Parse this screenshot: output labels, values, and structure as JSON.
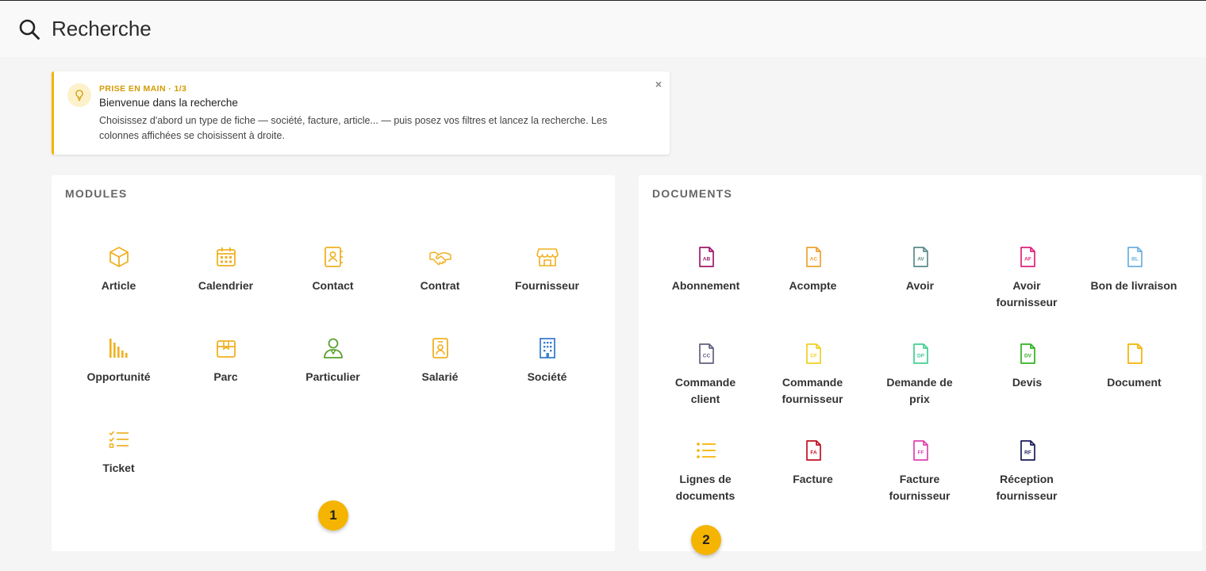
{
  "header": {
    "title": "Recherche"
  },
  "tip": {
    "kicker": "PRISE EN MAIN · 1/3",
    "heading": "Bienvenue dans la recherche",
    "body": "Choisissez d'abord un type de fiche — société, facture, article... — puis posez vos filtres et lancez la recherche. Les colonnes affichées se choisissent à droite.",
    "close": "×"
  },
  "modules": {
    "title": "MODULES",
    "items": [
      {
        "label": "Article",
        "icon": "box-icon"
      },
      {
        "label": "Calendrier",
        "icon": "calendar-icon"
      },
      {
        "label": "Contact",
        "icon": "contact-book-icon"
      },
      {
        "label": "Contrat",
        "icon": "handshake-icon"
      },
      {
        "label": "Fournisseur",
        "icon": "store-icon"
      },
      {
        "label": "Opportunité",
        "icon": "bar-chart-icon"
      },
      {
        "label": "Parc",
        "icon": "package-icon"
      },
      {
        "label": "Particulier",
        "icon": "person-icon"
      },
      {
        "label": "Salarié",
        "icon": "badge-icon"
      },
      {
        "label": "Société",
        "icon": "building-icon"
      },
      {
        "label": "Ticket",
        "icon": "checklist-icon"
      }
    ]
  },
  "documents": {
    "title": "DOCUMENTS",
    "items": [
      {
        "label": "Abonnement",
        "code": "AB",
        "color": "#a0186a"
      },
      {
        "label": "Acompte",
        "code": "AC",
        "color": "#f0a030"
      },
      {
        "label": "Avoir",
        "code": "AV",
        "color": "#5a8a8a"
      },
      {
        "label": "Avoir fournisseur",
        "code": "AF",
        "color": "#e0207a"
      },
      {
        "label": "Bon de livraison",
        "code": "BL",
        "color": "#6ab0e0"
      },
      {
        "label": "Commande client",
        "code": "CC",
        "color": "#606080"
      },
      {
        "label": "Commande fournisseur",
        "code": "CF",
        "color": "#f0d020"
      },
      {
        "label": "Demande de prix",
        "code": "DP",
        "color": "#40d090"
      },
      {
        "label": "Devis",
        "code": "DV",
        "color": "#30b020"
      },
      {
        "label": "Document",
        "code": "",
        "color": "#f5b400"
      },
      {
        "label": "Lignes de documents",
        "code": "",
        "color": "#f5b400"
      },
      {
        "label": "Facture",
        "code": "FA",
        "color": "#c01020"
      },
      {
        "label": "Facture fournisseur",
        "code": "FF",
        "color": "#e040b0"
      },
      {
        "label": "Réception fournisseur",
        "code": "RF",
        "color": "#1a1a5a"
      }
    ]
  },
  "markers": [
    "1",
    "2"
  ],
  "colors": {
    "accent": "#f5b400",
    "module_icon": "#f0b020",
    "person_icon": "#5aa02c",
    "building_icon": "#3a7fd0"
  }
}
